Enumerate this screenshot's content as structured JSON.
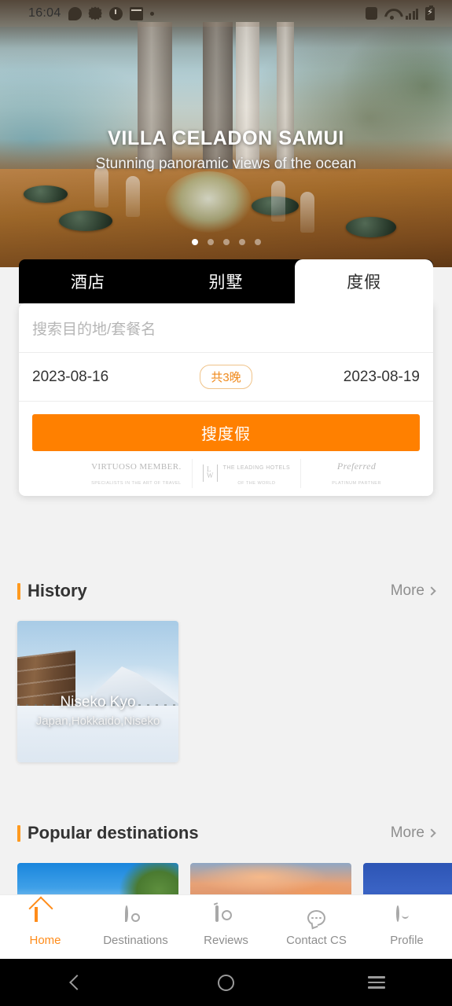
{
  "status_bar": {
    "time": "16:04",
    "left_icons": [
      "chat-icon",
      "gear-icon",
      "clock-icon",
      "mail-icon",
      "dot-icon"
    ],
    "right_icons": [
      "vibrate-icon",
      "wifi-icon",
      "signal-icon",
      "battery-charging-icon"
    ]
  },
  "hero": {
    "title": "VILLA CELADON SAMUI",
    "subtitle": "Stunning panoramic views of the ocean",
    "dot_count": 5,
    "active_dot": 0
  },
  "search": {
    "tabs": [
      {
        "label": "酒店",
        "active": false
      },
      {
        "label": "别墅",
        "active": false
      },
      {
        "label": "度假",
        "active": true
      }
    ],
    "destination_placeholder": "搜索目的地/套餐名",
    "check_in": "2023-08-16",
    "check_out": "2023-08-19",
    "nights_badge": "共3晚",
    "search_button": "搜度假",
    "accent_color": "#ff8000",
    "badge_color": "#f08a1c"
  },
  "partners": [
    {
      "name": "VIRTUOSO MEMBER.",
      "tagline": "SPECIALISTS IN THE ART OF TRAVEL",
      "mark": "shell-icon"
    },
    {
      "name": "THE LEADING HOTELS",
      "tagline": "OF THE WORLD",
      "mark": "lhw-icon"
    },
    {
      "name": "Preferred",
      "tagline": "PLATINUM PARTNER",
      "mark": "tree-icon"
    }
  ],
  "history": {
    "title": "History",
    "more_label": "More",
    "cards": [
      {
        "name": "Niseko Kyo",
        "location": "Japan,Hokkaido,Niseko"
      }
    ]
  },
  "popular": {
    "title": "Popular destinations",
    "more_label": "More",
    "card_count": 3
  },
  "bottom_nav": [
    {
      "label": "Home",
      "icon": "home-icon",
      "active": true
    },
    {
      "label": "Destinations",
      "icon": "map-pin-icon",
      "active": false
    },
    {
      "label": "Reviews",
      "icon": "camera-icon",
      "active": false
    },
    {
      "label": "Contact CS",
      "icon": "chat-bubble-icon",
      "active": false
    },
    {
      "label": "Profile",
      "icon": "smiley-face-icon",
      "active": false
    }
  ],
  "android_nav": {
    "back": "back-icon",
    "home": "home-circle-icon",
    "recents": "menu-icon"
  }
}
